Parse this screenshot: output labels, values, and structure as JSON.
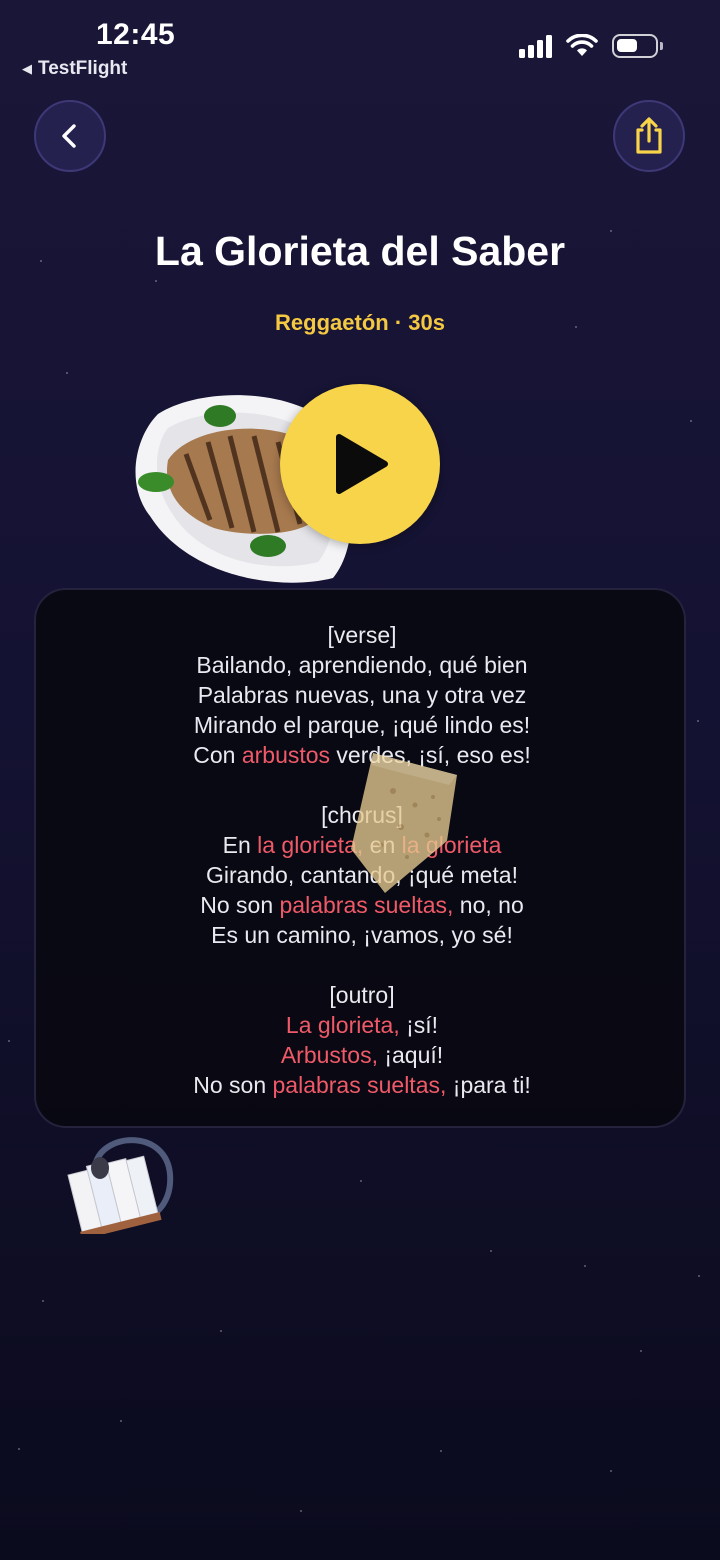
{
  "status_bar": {
    "time": "12:45",
    "back_app": "TestFlight",
    "icons": [
      "signal-icon",
      "wifi-icon",
      "battery-icon"
    ]
  },
  "header": {
    "back_icon": "chevron-left-icon",
    "share_icon": "share-icon"
  },
  "song": {
    "title": "La Glorieta del Saber",
    "meta": "Reggaetón · 30s",
    "play_icon": "play-icon"
  },
  "colors": {
    "accent_yellow": "#f7d44a",
    "meta_yellow": "#f5c842",
    "highlight_red": "#f05a68",
    "background": "#15133a"
  },
  "lyrics": [
    {
      "parts": [
        {
          "t": "[verse]",
          "hl": false
        }
      ]
    },
    {
      "parts": [
        {
          "t": "Bailando, aprendiendo, qué bien",
          "hl": false
        }
      ]
    },
    {
      "parts": [
        {
          "t": "Palabras nuevas, una y otra vez",
          "hl": false
        }
      ]
    },
    {
      "parts": [
        {
          "t": "Mirando el parque, ¡qué lindo es!",
          "hl": false
        }
      ]
    },
    {
      "parts": [
        {
          "t": "Con ",
          "hl": false
        },
        {
          "t": "arbustos",
          "hl": true
        },
        {
          "t": " verdes, ¡sí, eso es!",
          "hl": false
        }
      ]
    },
    {
      "gap": true
    },
    {
      "parts": [
        {
          "t": "[chorus]",
          "hl": false
        }
      ]
    },
    {
      "parts": [
        {
          "t": "En ",
          "hl": false
        },
        {
          "t": "la glorieta,",
          "hl": true
        },
        {
          "t": " en ",
          "hl": false
        },
        {
          "t": "la glorieta",
          "hl": true
        }
      ]
    },
    {
      "parts": [
        {
          "t": "Girando, cantando, ¡qué meta!",
          "hl": false
        }
      ]
    },
    {
      "parts": [
        {
          "t": "No son ",
          "hl": false
        },
        {
          "t": "palabras sueltas,",
          "hl": true
        },
        {
          "t": " no, no",
          "hl": false
        }
      ]
    },
    {
      "parts": [
        {
          "t": "Es un camino, ¡vamos, yo sé!",
          "hl": false
        }
      ]
    },
    {
      "gap": true
    },
    {
      "parts": [
        {
          "t": "[outro]",
          "hl": false
        }
      ]
    },
    {
      "parts": [
        {
          "t": "La glorieta,",
          "hl": true
        },
        {
          "t": " ¡sí!",
          "hl": false
        }
      ]
    },
    {
      "parts": [
        {
          "t": "Arbustos,",
          "hl": true
        },
        {
          "t": " ¡aquí!",
          "hl": false
        }
      ]
    },
    {
      "parts": [
        {
          "t": "No son ",
          "hl": false
        },
        {
          "t": "palabras sueltas,",
          "hl": true
        },
        {
          "t": " ¡para ti!",
          "hl": false
        }
      ]
    }
  ]
}
